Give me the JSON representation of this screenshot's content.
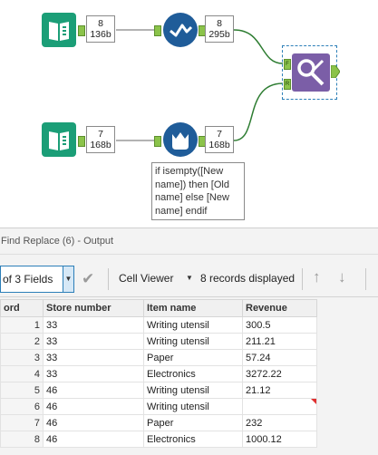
{
  "canvas": {
    "badges": [
      {
        "count": "8",
        "size": "136b"
      },
      {
        "count": "8",
        "size": "295b"
      },
      {
        "count": "7",
        "size": "168b"
      },
      {
        "count": "7",
        "size": "168b"
      }
    ],
    "anchors": {
      "find": "F",
      "replace": "R"
    },
    "annotation": "if isempty([New name]) then [Old name] else [New name] endif",
    "colors": {
      "input_tool": "#1b9e77",
      "formula_tool": "#1f5c99",
      "find_replace_tool": "#7b5ea7",
      "anchor": "#8bc34a"
    }
  },
  "results": {
    "title": "Find Replace (6) - Output",
    "field_selector": "of 3 Fields",
    "cell_viewer": "Cell Viewer",
    "record_count": "8 records displayed",
    "columns": [
      "ord",
      "Store number",
      "Item name",
      "Revenue"
    ],
    "rows": [
      {
        "n": "1",
        "store": "33",
        "item": "Writing utensil",
        "revenue": "300.5"
      },
      {
        "n": "2",
        "store": "33",
        "item": "Writing utensil",
        "revenue": "211.21"
      },
      {
        "n": "3",
        "store": "33",
        "item": "Paper",
        "revenue": "57.24"
      },
      {
        "n": "4",
        "store": "33",
        "item": "Electronics",
        "revenue": "3272.22"
      },
      {
        "n": "5",
        "store": "46",
        "item": "Writing utensil",
        "revenue": "21.12"
      },
      {
        "n": "6",
        "store": "46",
        "item": "Writing utensil",
        "revenue": ""
      },
      {
        "n": "7",
        "store": "46",
        "item": "Paper",
        "revenue": "232"
      },
      {
        "n": "8",
        "store": "46",
        "item": "Electronics",
        "revenue": "1000.12"
      }
    ]
  }
}
